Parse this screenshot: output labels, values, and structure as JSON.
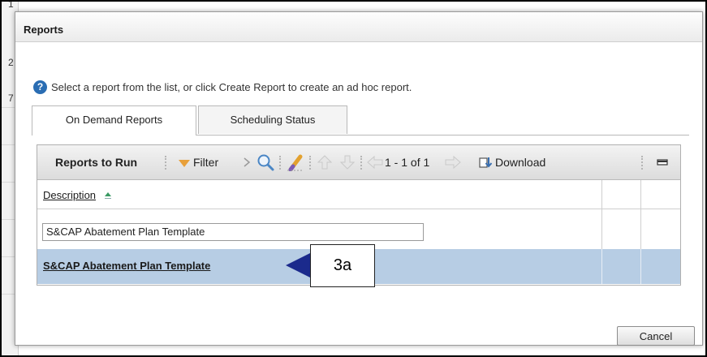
{
  "dialog": {
    "title": "Reports",
    "help_text": "Select a report from the list, or click Create Report to create an ad hoc report.",
    "cancel_label": "Cancel"
  },
  "tabs": [
    {
      "label": "On Demand Reports",
      "active": true
    },
    {
      "label": "Scheduling Status",
      "active": false
    }
  ],
  "toolbar": {
    "title": "Reports to Run",
    "filter_label": "Filter",
    "pagination": "1 - 1 of 1",
    "download_label": "Download"
  },
  "table": {
    "column_header": "Description",
    "filter_value": "S&CAP Abatement Plan Template",
    "rows": [
      {
        "description": "S&CAP Abatement Plan Template",
        "selected": true
      }
    ]
  },
  "callout": {
    "label": "3a"
  },
  "background_fragments": [
    "1",
    "2",
    "7"
  ],
  "colors": {
    "accent": "#2a6db3",
    "selected_row": "#b7cde4",
    "callout_arrow": "#1b2a8c",
    "filter_icon": "#e8a03a"
  },
  "icons": [
    "help-icon",
    "filter-icon",
    "chevron-right-icon",
    "search-icon",
    "clear-filter-icon",
    "move-up-icon",
    "move-down-icon",
    "prev-page-icon",
    "next-page-icon",
    "download-icon",
    "minimize-icon",
    "sort-ascending-icon"
  ]
}
